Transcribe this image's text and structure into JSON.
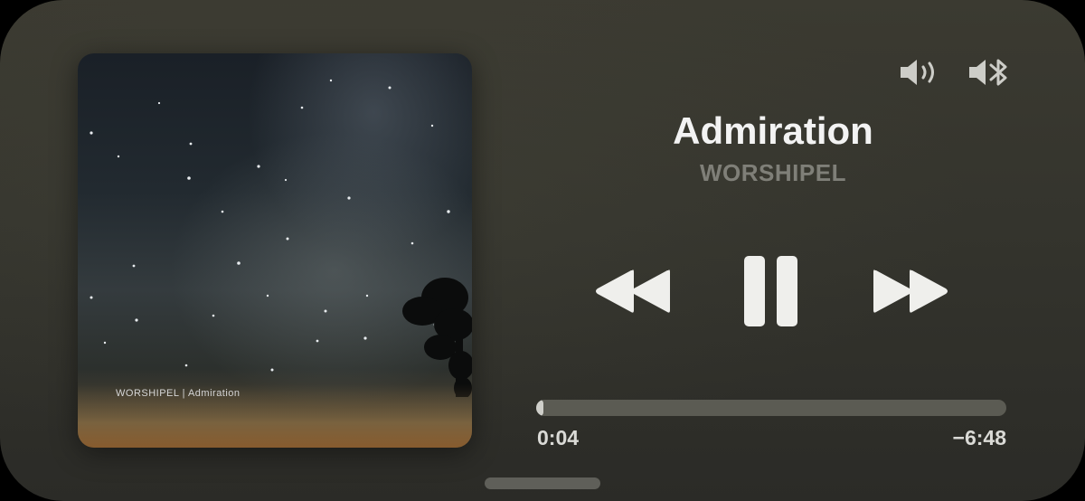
{
  "artwork": {
    "caption": "WORSHIPEL  |  Admiration",
    "icon": "album-artwork"
  },
  "track": {
    "title": "Admiration",
    "artist": "WORSHIPEL"
  },
  "playback": {
    "state": "playing",
    "elapsed": "0:04",
    "remaining": "−6:48",
    "progress_fraction": 0.01
  },
  "controls": {
    "rewind_icon": "rewind-icon",
    "pause_icon": "pause-icon",
    "forward_icon": "fast-forward-icon"
  },
  "status_icons": {
    "volume": "speaker-volume-icon",
    "bluetooth": "bluetooth-speaker-icon"
  },
  "colors": {
    "panel_background": "#34342d",
    "title": "#f3f3f3",
    "artist": "#7f7f78",
    "track": "#5b5b53",
    "fill": "#cfcfca"
  }
}
